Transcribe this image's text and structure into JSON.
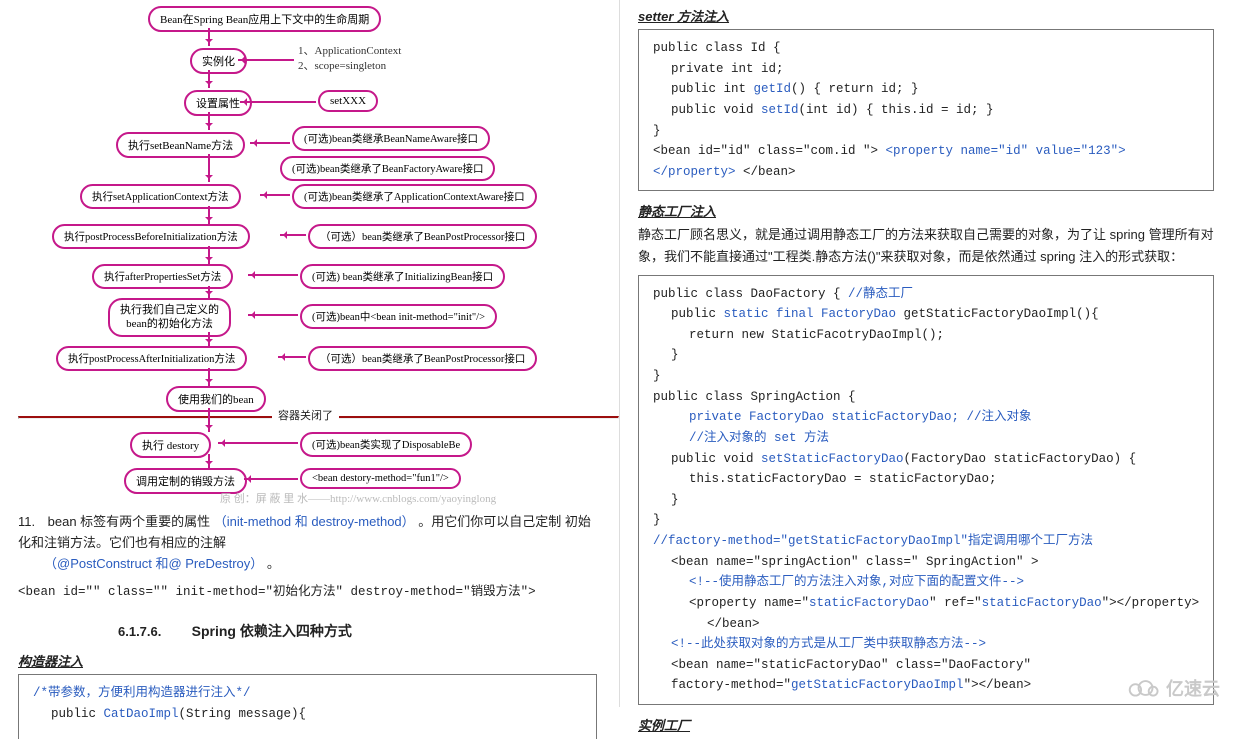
{
  "flow": {
    "n0": "Bean在Spring Bean应用上下文中的生命周期",
    "n1": "实例化",
    "n1r": "1、ApplicationContext\n2、scope=singleton",
    "n2": "设置属性",
    "n2r": "setXXX",
    "n3": "执行setBeanName方法",
    "n3r": "(可选)bean类继承BeanNameAware接口",
    "n3r2": "(可选)bean类继承了BeanFactoryAware接口",
    "n4": "执行setApplicationContext方法",
    "n4r": "(可选)bean类继承了ApplicationContextAware接口",
    "n5": "执行postProcessBeforeInitialization方法",
    "n5r": "（可选）bean类继承了BeanPostProcessor接口",
    "n6": "执行afterPropertiesSet方法",
    "n6r": "(可选) bean类继承了InitializingBean接口",
    "n7": "执行我们自己定义的\nbean的初始化方法",
    "n7r": "(可选)bean中<bean init-method=\"init\"/>",
    "n8": "执行postProcessAfterInitialization方法",
    "n8r": "（可选）bean类继承了BeanPostProcessor接口",
    "n9": "使用我们的bean",
    "sep": "容器关闭了",
    "n10": "执行 destory",
    "n10r": "(可选)bean类实现了DisposableBe",
    "n11": "调用定制的销毁方法",
    "n11r": "<bean destory-method=\"fun1\"/>",
    "wm": "原 创：屏 蔽 里 水——http://www.cnblogs.com/yaoyinglong"
  },
  "li11": {
    "num": "11.",
    "a": "bean 标签有两个重要的属性",
    "b": "（init-method 和 destroy-method）",
    "c": "。用它们你可以自己定制 初始化和注销方法。它们也有相应的注解",
    "d": "（@PostConstruct 和@ PreDestroy）",
    "e": "。"
  },
  "beanTag": "<bean id=\"\" class=\"\" init-method=\"初始化方法\"  destroy-method=\"销毁方法\">",
  "sect": {
    "num": "6.1.7.6.",
    "title": "Spring 依赖注入四种方式"
  },
  "leftH1": "构造器注入",
  "leftCode": {
    "l1": "/*带参数，方便利用构造器进行注入*/",
    "l2a": "public ",
    "l2b": "CatDaoImpl",
    "l2c": "(String message){"
  },
  "rH1": "setter 方法注入",
  "code1": {
    "l1": "public class Id {",
    "l2": "private int id;",
    "l3a": "public int ",
    "l3b": "getId",
    "l3c": "() {    return id;   }",
    "l4a": "public void ",
    "l4b": "setId",
    "l4c": "(int id) {     this.id = id;   }",
    "l5": "}",
    "l6a": "<bean id=\"id\" class=\"com.id \">  ",
    "l6b": "<property name=\"id\" value=\"123\"></property>",
    "l6c": "  </bean>"
  },
  "rH2": "静态工厂注入",
  "rP2": "静态工厂顾名思义，就是通过调用静态工厂的方法来获取自己需要的对象，为了让 spring 管理所有对象，我们不能直接通过\"工程类.静态方法()\"来获取对象，而是依然通过 spring 注入的形式获取：",
  "code2": {
    "l1a": "public class DaoFactory {   ",
    "l1b": "//静态工厂",
    "l2a": "public ",
    "l2b": "static final FactoryDao",
    "l2c": " getStaticFactoryDaoImpl(){",
    "l3": "return new StaticFacotryDaoImpl();",
    "l4": "}",
    "l5": "}",
    "l6": "public class SpringAction {",
    "l7a": "private FactoryDao staticFactoryDao;  ",
    "l7b": "//注入对象",
    "l8": "//注入对象的 set 方法",
    "l9a": "public void ",
    "l9b": "setStaticFactoryDao",
    "l9c": "(FactoryDao staticFactoryDao) {",
    "l10": "this.staticFactoryDao = staticFactoryDao;",
    "l11": "}",
    "l12": "}",
    "l13": "//factory-method=\"getStaticFactoryDaoImpl\"指定调用哪个工厂方法",
    "l14": "<bean name=\"springAction\" class=\" SpringAction\" >",
    "l15": "<!--使用静态工厂的方法注入对象,对应下面的配置文件-->",
    "l16a": "<property name=\"",
    "l16b": "staticFactoryDao",
    "l16c": "\" ref=\"",
    "l16d": "staticFactoryDao",
    "l16e": "\"></property>",
    "l17": "</bean>",
    "l18": "<!--此处获取对象的方式是从工厂类中获取静态方法-->",
    "l19": "<bean name=\"staticFactoryDao\" class=\"DaoFactory\"",
    "l20a": "factory-method=\"",
    "l20b": "getStaticFactoryDaoImpl",
    "l20c": "\"></bean>"
  },
  "rH3": "实例工厂",
  "logo": "亿速云"
}
